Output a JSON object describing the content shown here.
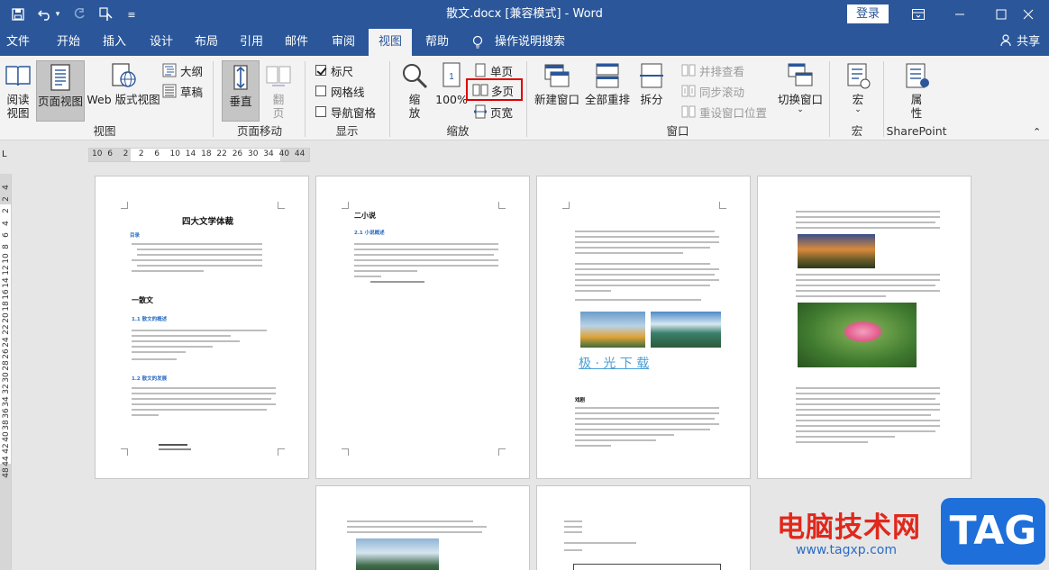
{
  "titlebar": {
    "title": "散文.docx [兼容模式]  -  Word",
    "login": "登录"
  },
  "tabs": [
    "文件",
    "开始",
    "插入",
    "设计",
    "布局",
    "引用",
    "邮件",
    "审阅",
    "视图",
    "帮助",
    "操作说明搜索"
  ],
  "active_tab": "视图",
  "share": "共享",
  "ribbon": {
    "views": {
      "read": "阅读\n视图",
      "print": "页面视图",
      "web": "Web 版式视图",
      "outline": "大纲",
      "draft": "草稿",
      "group": "视图"
    },
    "page_move": {
      "vertical": "垂直",
      "side": "翻\n页",
      "group": "页面移动"
    },
    "show": {
      "ruler": "标尺",
      "gridlines": "网格线",
      "nav": "导航窗格",
      "group": "显示"
    },
    "zoom": {
      "zoom": "缩\n放",
      "percent": "100%",
      "one_page": "单页",
      "multi_page": "多页",
      "page_width": "页宽",
      "group": "缩放"
    },
    "window": {
      "new": "新建窗口",
      "arrange": "全部重排",
      "split": "拆分",
      "side_by_side": "并排查看",
      "sync_scroll": "同步滚动",
      "reset_pos": "重设窗口位置",
      "switch": "切换窗口",
      "group": "窗口"
    },
    "macros": {
      "label": "宏",
      "group": "宏"
    },
    "sharepoint": {
      "label": "属\n性",
      "group": "SharePoint"
    }
  },
  "hruler_ticks": [
    "10",
    "6",
    "2",
    "2",
    "6",
    "10",
    "14",
    "18",
    "22",
    "26",
    "30",
    "34",
    "40",
    "44"
  ],
  "vruler_ticks": [
    "4",
    "2",
    "2",
    "4",
    "6",
    "8",
    "10",
    "12",
    "14",
    "16",
    "18",
    "20",
    "22",
    "24",
    "26",
    "28",
    "30",
    "32",
    "34",
    "36",
    "38",
    "40",
    "42",
    "44",
    "48"
  ],
  "pages": {
    "p1_title": "四大文学体裁",
    "p1_toc": "目录",
    "p1_heading": "一散文",
    "p1_sub1": "1.1 散文的概述",
    "p1_sub2": "1.2 散文的发展",
    "p2_heading": "二小说",
    "p2_sub": "2.1 小说概述",
    "p3_caption": "极 · 光 下 载",
    "p3_sub": "戏剧"
  },
  "watermark": {
    "text": "电脑技术网",
    "url": "www.tagxp.com",
    "tag": "TAG"
  }
}
